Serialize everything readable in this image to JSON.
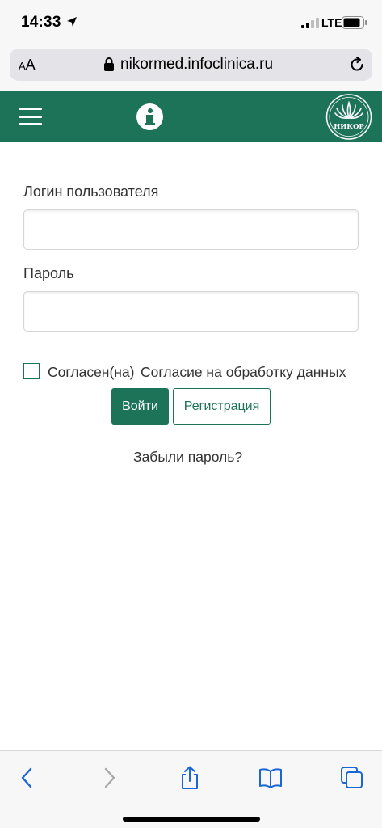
{
  "status_bar": {
    "time": "14:33",
    "network": "LTE"
  },
  "browser": {
    "text_size_small": "A",
    "text_size_large": "A",
    "url": "nikormed.infoclinica.ru"
  },
  "header": {
    "logo_text": "НИКОР",
    "accent_color": "#1c7357",
    "icons": [
      "menu-icon",
      "info-icon",
      "logo"
    ]
  },
  "form": {
    "login_label": "Логин пользователя",
    "login_value": "",
    "password_label": "Пароль",
    "password_value": "",
    "consent_text": "Согласен(на)",
    "consent_link": "Согласие на обработку данных",
    "consent_checked": false,
    "login_button": "Войти",
    "register_button": "Регистрация",
    "forgot_link": "Забыли пароль?"
  },
  "toolbar": {
    "icons": [
      "back-icon",
      "forward-icon",
      "share-icon",
      "bookmarks-icon",
      "tabs-icon"
    ],
    "tint_color": "#1a66d6"
  }
}
